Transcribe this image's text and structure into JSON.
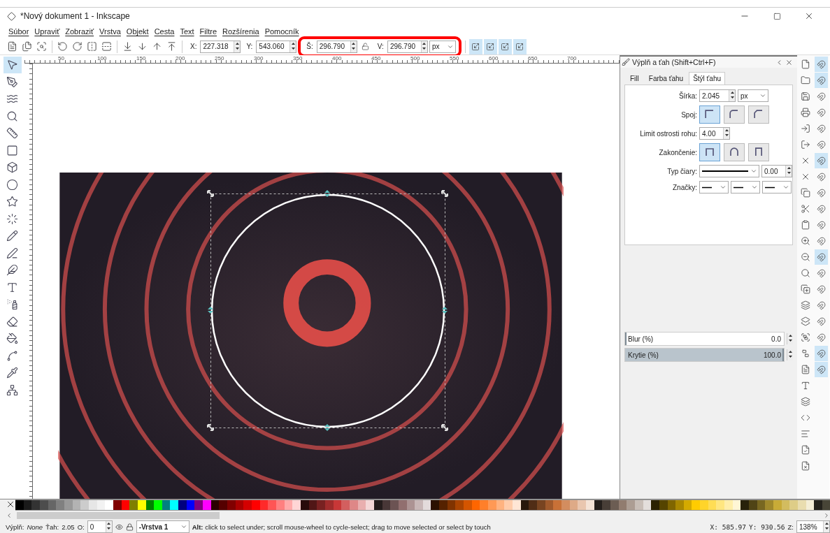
{
  "window": {
    "title": "*Nový dokument 1 - Inkscape"
  },
  "menu": [
    {
      "label": "Súbor"
    },
    {
      "label": "Upraviť"
    },
    {
      "label": "Zobraziť"
    },
    {
      "label": "Vrstva"
    },
    {
      "label": "Objekt"
    },
    {
      "label": "Cesta"
    },
    {
      "label": "Text"
    },
    {
      "label": "Filtre"
    },
    {
      "label": "Rozšírenia"
    },
    {
      "label": "Pomocník"
    }
  ],
  "toolbar": {
    "fields": [
      {
        "label": "X:",
        "value": "227.318"
      },
      {
        "label": "Y:",
        "value": "543.060"
      },
      {
        "label": "Š:",
        "value": "296.790"
      },
      {
        "label": "V:",
        "value": "296.790"
      }
    ],
    "unit": "px",
    "lock_on": false
  },
  "ruler": {
    "labels": [
      "50",
      "100",
      "150",
      "200",
      "250",
      "300",
      "350",
      "400",
      "450",
      "500",
      "550",
      "600",
      "650",
      "700"
    ]
  },
  "dock": {
    "title": "Výplň a ťah (Shift+Ctrl+F)",
    "tabs": [
      {
        "label": "Fill",
        "selected": false
      },
      {
        "label": "Farba ťahu",
        "selected": false
      },
      {
        "label": "Štýl ťahu",
        "selected": true
      }
    ],
    "width": {
      "label": "Šírka:",
      "value": "2.045",
      "unit": "px"
    },
    "join": {
      "label": "Spoj:",
      "options": [
        {
          "selected": true
        },
        {
          "selected": false
        },
        {
          "selected": false
        }
      ]
    },
    "miter": {
      "label": "Limit ostrosti rohu:",
      "value": "4.00"
    },
    "cap": {
      "label": "Zakončenie:",
      "options": [
        {
          "selected": true
        },
        {
          "selected": false
        },
        {
          "selected": false
        }
      ]
    },
    "dash": {
      "label": "Typ čiary:",
      "value": "0.00"
    },
    "markers": {
      "label": "Značky:"
    },
    "sliders": [
      {
        "label": "Blur (%)",
        "value": "0.0",
        "level": 0
      },
      {
        "label": "Krytie (%)",
        "value": "100.0",
        "level": 1
      }
    ]
  },
  "palette": [
    {
      "color": "#000000"
    },
    {
      "color": "#1a1a1a"
    },
    {
      "color": "#333333"
    },
    {
      "color": "#4d4d4d"
    },
    {
      "color": "#666666"
    },
    {
      "color": "#808080"
    },
    {
      "color": "#999999"
    },
    {
      "color": "#b3b3b3"
    },
    {
      "color": "#cccccc"
    },
    {
      "color": "#e6e6e6"
    },
    {
      "color": "#f2f2f2"
    },
    {
      "color": "#ffffff"
    },
    {
      "color": "#800000"
    },
    {
      "color": "#ff0000"
    },
    {
      "color": "#808000"
    },
    {
      "color": "#ffff00"
    },
    {
      "color": "#008000"
    },
    {
      "color": "#00ff00"
    },
    {
      "color": "#008080"
    },
    {
      "color": "#00ffff"
    },
    {
      "color": "#000080"
    },
    {
      "color": "#0000ff"
    },
    {
      "color": "#800080"
    },
    {
      "color": "#ff00ff"
    },
    {
      "color": "#2b0000"
    },
    {
      "color": "#550000"
    },
    {
      "color": "#800000"
    },
    {
      "color": "#aa0000"
    },
    {
      "color": "#d40000"
    },
    {
      "color": "#ff0000"
    },
    {
      "color": "#ff2a2a"
    },
    {
      "color": "#ff5555"
    },
    {
      "color": "#ff8080"
    },
    {
      "color": "#ffaaaa"
    },
    {
      "color": "#ffd5d5"
    },
    {
      "color": "#280b0b"
    },
    {
      "color": "#501616"
    },
    {
      "color": "#782121"
    },
    {
      "color": "#a02c2c"
    },
    {
      "color": "#c83737"
    },
    {
      "color": "#d35f5f"
    },
    {
      "color": "#de8787"
    },
    {
      "color": "#e9afaf"
    },
    {
      "color": "#f4d7d7"
    },
    {
      "color": "#241c1c"
    },
    {
      "color": "#483737"
    },
    {
      "color": "#6c5353"
    },
    {
      "color": "#916f6f"
    },
    {
      "color": "#ac9393"
    },
    {
      "color": "#c8b7b7"
    },
    {
      "color": "#e3dbdb"
    },
    {
      "color": "#2b1100"
    },
    {
      "color": "#552200"
    },
    {
      "color": "#803300"
    },
    {
      "color": "#aa4400"
    },
    {
      "color": "#d45500"
    },
    {
      "color": "#ff6600"
    },
    {
      "color": "#ff7f2a"
    },
    {
      "color": "#ff9955"
    },
    {
      "color": "#ffb380"
    },
    {
      "color": "#ffccaa"
    },
    {
      "color": "#ffe6d5"
    },
    {
      "color": "#28170b"
    },
    {
      "color": "#502d16"
    },
    {
      "color": "#784421"
    },
    {
      "color": "#a05a2c"
    },
    {
      "color": "#c87137"
    },
    {
      "color": "#d38d5f"
    },
    {
      "color": "#deaa87"
    },
    {
      "color": "#e9c6af"
    },
    {
      "color": "#f4e3d7"
    },
    {
      "color": "#241f1c"
    },
    {
      "color": "#483e37"
    },
    {
      "color": "#6c5d53"
    },
    {
      "color": "#917c6f"
    },
    {
      "color": "#ac9d93"
    },
    {
      "color": "#c8beb7"
    },
    {
      "color": "#e3dedb"
    },
    {
      "color": "#2b2200"
    },
    {
      "color": "#554400"
    },
    {
      "color": "#806600"
    },
    {
      "color": "#aa8800"
    },
    {
      "color": "#d4aa00"
    },
    {
      "color": "#ffcc00"
    },
    {
      "color": "#ffd42a"
    },
    {
      "color": "#ffdd55"
    },
    {
      "color": "#ffe680"
    },
    {
      "color": "#ffeeaa"
    },
    {
      "color": "#fff6d5"
    },
    {
      "color": "#28220b"
    },
    {
      "color": "#504416"
    },
    {
      "color": "#786721"
    },
    {
      "color": "#a0892c"
    },
    {
      "color": "#c8ab37"
    },
    {
      "color": "#d3bc5f"
    },
    {
      "color": "#decd87"
    },
    {
      "color": "#e9ddaf"
    },
    {
      "color": "#f4eed7"
    },
    {
      "color": "#24221c"
    },
    {
      "color": "#484537"
    }
  ],
  "status": {
    "fill_label": "Výplň:",
    "fill_value": "None",
    "stroke_label": "Ťah:",
    "stroke_value": "2.05",
    "opacity_label": "O:",
    "opacity_value": "0",
    "layer": "-Vrstva 1",
    "message": "**Alt:** click to select under; scroll mouse-wheel to cycle-select; drag to move selected or select by touch",
    "x": "X:  585.97",
    "y": "Y:  930.56",
    "zoom_label": "Z:",
    "zoom": "138%"
  }
}
